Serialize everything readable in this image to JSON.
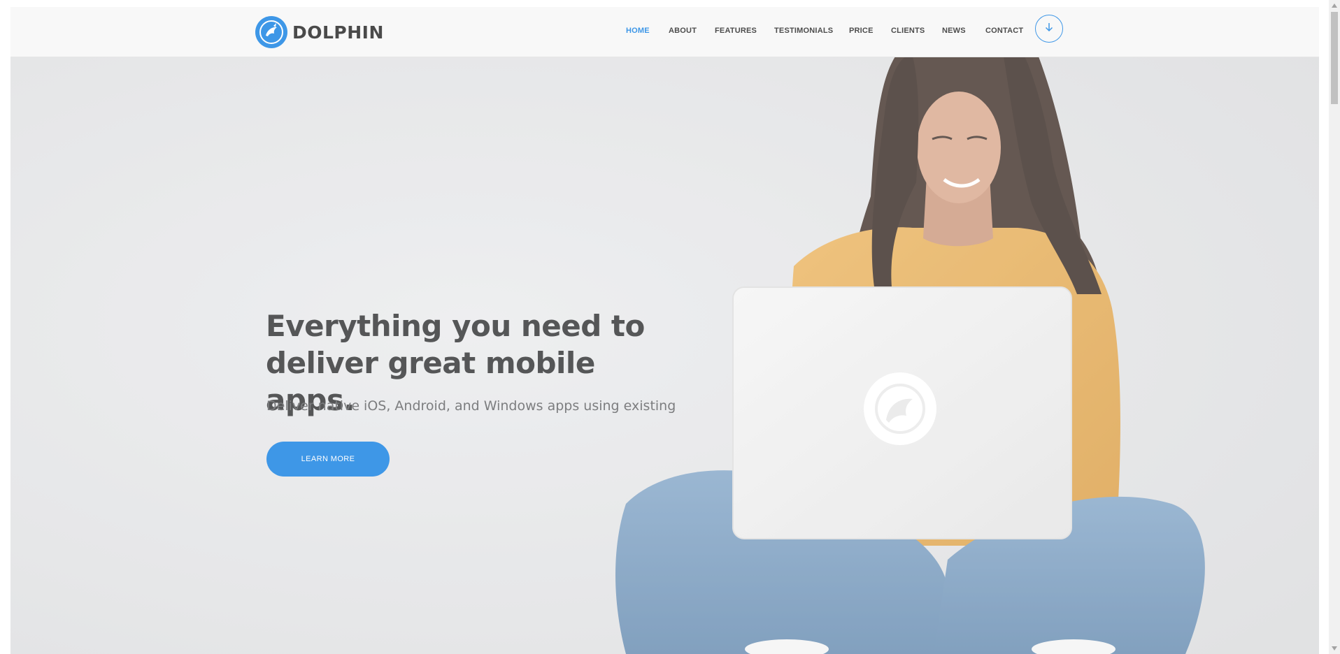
{
  "brand": {
    "name": "DOLPHIN",
    "logo_icon": "dolphin-logo-icon",
    "accent_color": "#3e97e7"
  },
  "nav": {
    "items": [
      {
        "label": "HOME",
        "active": true
      },
      {
        "label": "ABOUT",
        "active": false
      },
      {
        "label": "FEATURES",
        "active": false
      },
      {
        "label": "TESTIMONIALS",
        "active": false
      },
      {
        "label": "PRICE",
        "active": false
      },
      {
        "label": "CLIENTS",
        "active": false
      },
      {
        "label": "NEWS",
        "active": false
      },
      {
        "label": "CONTACT",
        "active": false
      }
    ],
    "download_icon": "arrow-down-icon"
  },
  "hero": {
    "title_line1": "Everything you need to",
    "title_line2": "deliver great mobile apps.",
    "subtitle": "Deliver native iOS, Android, and Windows apps using existing",
    "cta_label": "LEARN MORE",
    "image": "woman-with-laptop-photo"
  }
}
